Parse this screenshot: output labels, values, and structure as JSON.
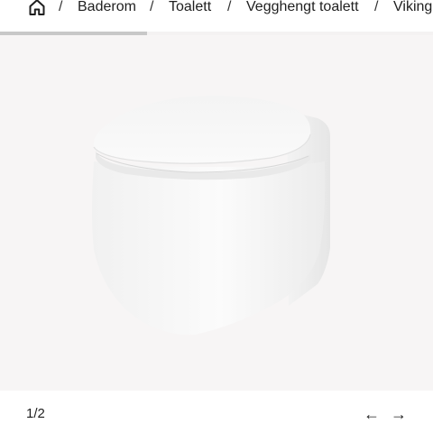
{
  "breadcrumb": {
    "home_icon": "home-icon",
    "separator": "/",
    "items": [
      {
        "label": "Baderom"
      },
      {
        "label": "Toalett"
      },
      {
        "label": "Vegghengt toalett"
      },
      {
        "label": "Viking"
      }
    ]
  },
  "gallery": {
    "progress": 0.5,
    "image_subject": "wall-hung toilet",
    "counter": "1/2",
    "prev_icon": "arrow-left-icon",
    "next_icon": "arrow-right-icon",
    "prev_symbol": "←",
    "next_symbol": "→"
  }
}
